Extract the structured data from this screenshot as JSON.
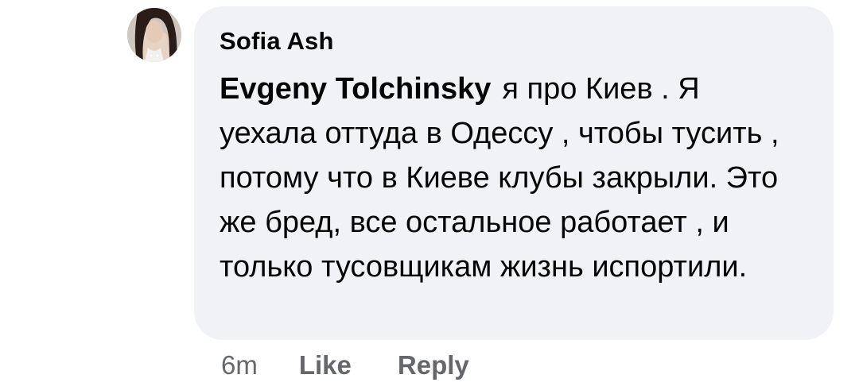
{
  "comment": {
    "author": "Sofia Ash",
    "mention": "Evgeny Tolchinsky",
    "text": "я про Киев . Я уехала оттуда в Одессу , чтобы тусить , потому что в Киеве клубы закрыли. Это же бред, все остальное работает , и только тусовщикам жизнь испортили.",
    "timestamp": "6m",
    "like_label": "Like",
    "reply_label": "Reply"
  },
  "colors": {
    "bubble_background": "#f0f2f5",
    "text": "#050505",
    "secondary_text": "#65676b"
  },
  "icons": {
    "avatar": "profile-photo"
  }
}
